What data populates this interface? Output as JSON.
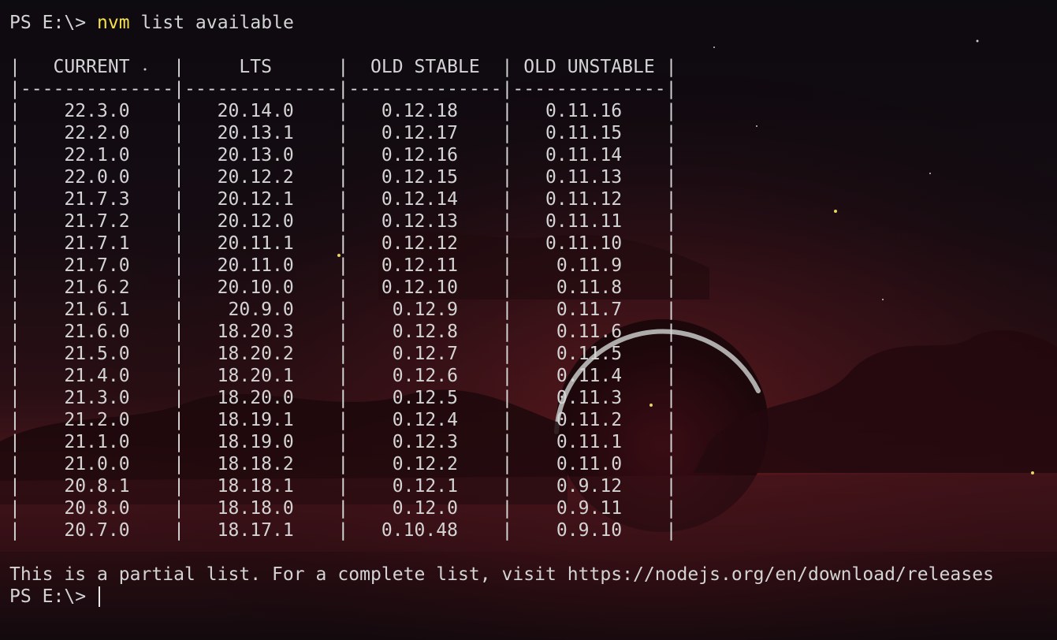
{
  "prompt": "PS E:\\> ",
  "command": {
    "name": "nvm",
    "args": " list available"
  },
  "table": {
    "header_row": "|   CURRENT    |     LTS      |  OLD STABLE  | OLD UNSTABLE |",
    "separator_row": "|--------------|--------------|--------------|--------------|",
    "rows": [
      "|    22.3.0    |   20.14.0    |   0.12.18    |   0.11.16    |",
      "|    22.2.0    |   20.13.1    |   0.12.17    |   0.11.15    |",
      "|    22.1.0    |   20.13.0    |   0.12.16    |   0.11.14    |",
      "|    22.0.0    |   20.12.2    |   0.12.15    |   0.11.13    |",
      "|    21.7.3    |   20.12.1    |   0.12.14    |   0.11.12    |",
      "|    21.7.2    |   20.12.0    |   0.12.13    |   0.11.11    |",
      "|    21.7.1    |   20.11.1    |   0.12.12    |   0.11.10    |",
      "|    21.7.0    |   20.11.0    |   0.12.11    |    0.11.9    |",
      "|    21.6.2    |   20.10.0    |   0.12.10    |    0.11.8    |",
      "|    21.6.1    |    20.9.0    |    0.12.9    |    0.11.7    |",
      "|    21.6.0    |   18.20.3    |    0.12.8    |    0.11.6    |",
      "|    21.5.0    |   18.20.2    |    0.12.7    |    0.11.5    |",
      "|    21.4.0    |   18.20.1    |    0.12.6    |    0.11.4    |",
      "|    21.3.0    |   18.20.0    |    0.12.5    |    0.11.3    |",
      "|    21.2.0    |   18.19.1    |    0.12.4    |    0.11.2    |",
      "|    21.1.0    |   18.19.0    |    0.12.3    |    0.11.1    |",
      "|    21.0.0    |   18.18.2    |    0.12.2    |    0.11.0    |",
      "|    20.8.1    |   18.18.1    |    0.12.1    |    0.9.12    |",
      "|    20.8.0    |   18.18.0    |    0.12.0    |    0.9.11    |",
      "|    20.7.0    |   18.17.1    |   0.10.48    |    0.9.10    |"
    ]
  },
  "footer_message": "This is a partial list. For a complete list, visit https://nodejs.org/en/download/releases",
  "final_prompt": "PS E:\\> ",
  "colors": {
    "background": "#140e14",
    "text": "#d4d4d4",
    "command_highlight": "#f3e04a"
  }
}
